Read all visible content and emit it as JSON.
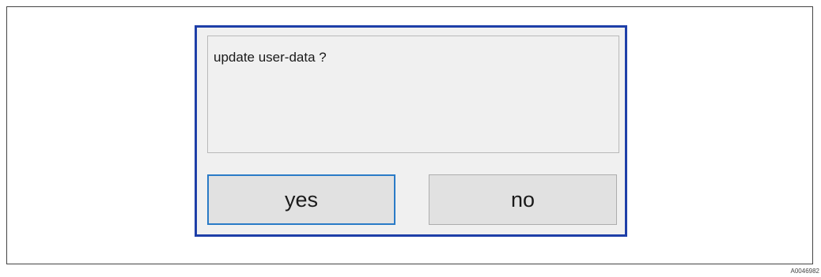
{
  "dialog": {
    "message": "update user-data ?",
    "buttons": {
      "yes_label": "yes",
      "no_label": "no"
    },
    "colors": {
      "dialog_border": "#1e3fa8",
      "focused_button_border": "#2a7bc7",
      "background": "#f0f0f0",
      "button_background": "#e1e1e1"
    }
  },
  "figure": {
    "id_label": "A0046982"
  }
}
